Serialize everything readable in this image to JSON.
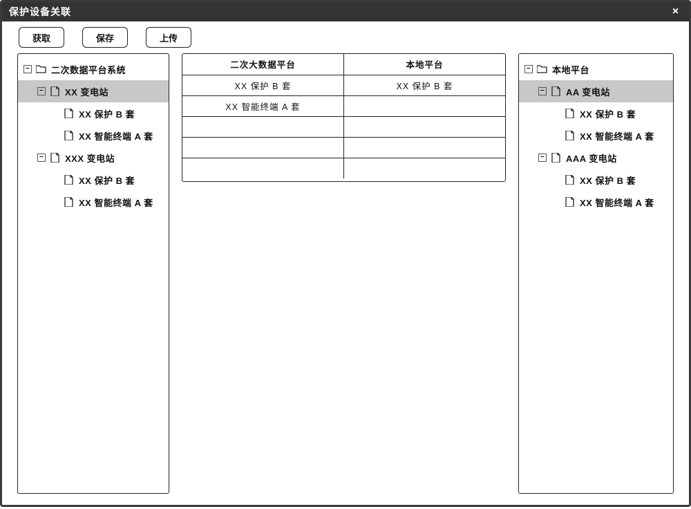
{
  "window": {
    "title": "保护设备关联"
  },
  "toolbar": {
    "fetch": "获取",
    "save": "保存",
    "upload": "上传"
  },
  "left_tree": {
    "root": {
      "label": "二次数据平台系统"
    },
    "stations": [
      {
        "label": "XX 变电站",
        "selected": true,
        "children": [
          {
            "label": "XX 保护 B 套"
          },
          {
            "label": "XX 智能终端 A 套"
          }
        ]
      },
      {
        "label": "XXX 变电站",
        "selected": false,
        "children": [
          {
            "label": "XX 保护 B 套"
          },
          {
            "label": "XX 智能终端 A 套"
          }
        ]
      }
    ]
  },
  "center_table": {
    "headers": [
      "二次大数据平台",
      "本地平台"
    ],
    "rows": [
      [
        "XX 保护 B 套",
        "XX 保护 B 套"
      ],
      [
        "XX 智能终端 A 套",
        ""
      ],
      [
        "",
        ""
      ],
      [
        "",
        ""
      ],
      [
        "",
        ""
      ]
    ]
  },
  "right_tree": {
    "root": {
      "label": "本地平台"
    },
    "stations": [
      {
        "label": "AA 变电站",
        "selected": true,
        "children": [
          {
            "label": "XX 保护 B 套"
          },
          {
            "label": "XX 智能终端 A 套"
          }
        ]
      },
      {
        "label": "AAA 变电站",
        "selected": false,
        "children": [
          {
            "label": "XX 保护 B 套"
          },
          {
            "label": "XX 智能终端 A 套"
          }
        ]
      }
    ]
  }
}
